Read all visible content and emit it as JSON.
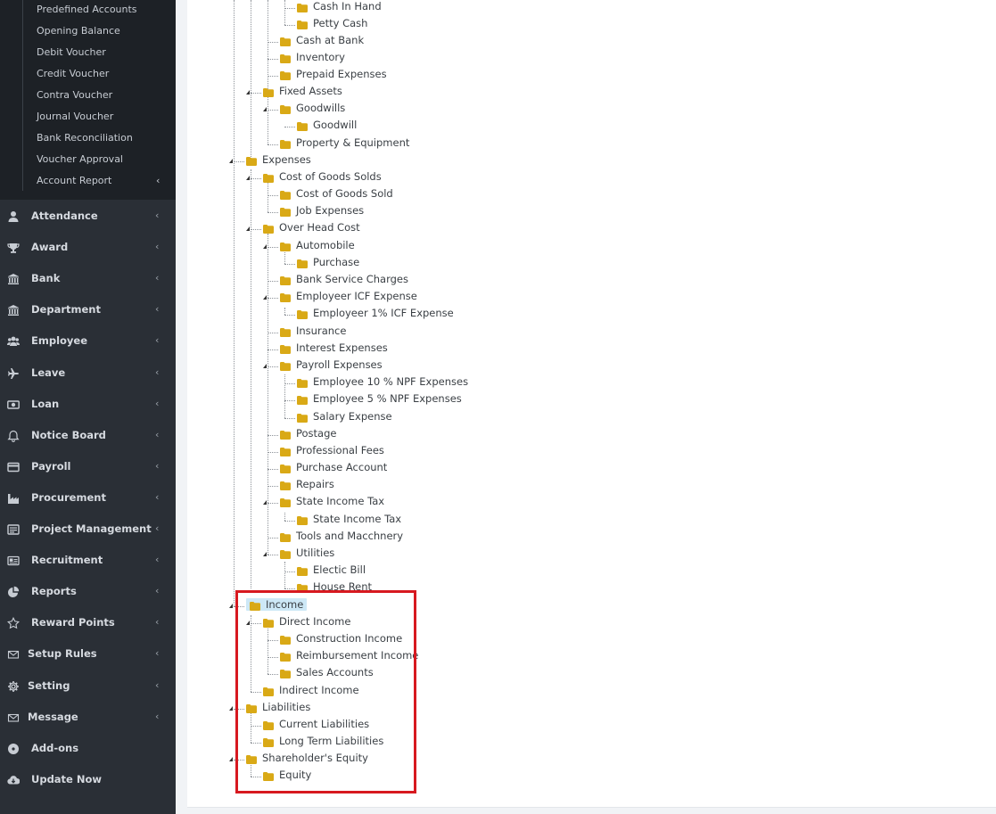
{
  "sidebar": {
    "submenu": [
      {
        "label": "Predefined Accounts"
      },
      {
        "label": "Opening Balance"
      },
      {
        "label": "Debit Voucher"
      },
      {
        "label": "Credit Voucher"
      },
      {
        "label": "Contra Voucher"
      },
      {
        "label": "Journal Voucher"
      },
      {
        "label": "Bank Reconciliation"
      },
      {
        "label": "Voucher Approval"
      },
      {
        "label": "Account Report",
        "chevron": "‹"
      }
    ],
    "items": [
      {
        "label": "Attendance",
        "icon": "user-icon",
        "chevron": "‹"
      },
      {
        "label": "Award",
        "icon": "trophy-icon",
        "chevron": "‹"
      },
      {
        "label": "Bank",
        "icon": "bank-icon",
        "chevron": "‹"
      },
      {
        "label": "Department",
        "icon": "bank-icon",
        "chevron": "‹"
      },
      {
        "label": "Employee",
        "icon": "users-icon",
        "chevron": "‹"
      },
      {
        "label": "Leave",
        "icon": "plane-icon",
        "chevron": "‹"
      },
      {
        "label": "Loan",
        "icon": "money-icon",
        "chevron": "‹"
      },
      {
        "label": "Notice Board",
        "icon": "bell-icon",
        "chevron": "‹"
      },
      {
        "label": "Payroll",
        "icon": "credit-card-icon",
        "chevron": "‹"
      },
      {
        "label": "Procurement",
        "icon": "industry-icon",
        "chevron": "‹"
      },
      {
        "label": "Project Management",
        "icon": "list-icon",
        "chevron": "‹"
      },
      {
        "label": "Recruitment",
        "icon": "id-card-icon",
        "chevron": "‹"
      },
      {
        "label": "Reports",
        "icon": "pie-chart-icon",
        "chevron": "‹"
      },
      {
        "label": "Reward Points",
        "icon": "star-icon",
        "chevron": "‹"
      },
      {
        "label": "Setup Rules",
        "icon": "envelope-icon",
        "chevron": "‹"
      },
      {
        "label": "Setting",
        "icon": "gear-icon",
        "chevron": "‹"
      },
      {
        "label": "Message",
        "icon": "envelope-icon",
        "chevron": "‹"
      },
      {
        "label": "Add-ons",
        "icon": "disc-icon",
        "chevron": ""
      },
      {
        "label": "Update Now",
        "icon": "cloud-download-icon",
        "chevron": ""
      }
    ]
  },
  "tree": [
    {
      "label": "Cash In Hand"
    },
    {
      "label": "Petty Cash"
    },
    {
      "label": "Cash at Bank"
    },
    {
      "label": "Inventory"
    },
    {
      "label": "Prepaid Expenses"
    },
    {
      "label": "Fixed Assets"
    },
    {
      "label": "Goodwills"
    },
    {
      "label": "Goodwill"
    },
    {
      "label": "Property & Equipment"
    },
    {
      "label": "Expenses"
    },
    {
      "label": "Cost of Goods Solds"
    },
    {
      "label": "Cost of Goods Sold"
    },
    {
      "label": "Job Expenses"
    },
    {
      "label": "Over Head Cost"
    },
    {
      "label": "Automobile"
    },
    {
      "label": "Purchase"
    },
    {
      "label": "Bank Service Charges"
    },
    {
      "label": "Employeer ICF Expense"
    },
    {
      "label": "Employeer 1% ICF Expense"
    },
    {
      "label": "Insurance"
    },
    {
      "label": "Interest Expenses"
    },
    {
      "label": "Payroll Expenses"
    },
    {
      "label": "Employee 10 % NPF Expenses"
    },
    {
      "label": "Employee 5 % NPF Expenses"
    },
    {
      "label": "Salary Expense"
    },
    {
      "label": "Postage"
    },
    {
      "label": "Professional Fees"
    },
    {
      "label": "Purchase Account"
    },
    {
      "label": "Repairs"
    },
    {
      "label": "State Income Tax"
    },
    {
      "label": "State Income Tax"
    },
    {
      "label": "Tools and Macchnery"
    },
    {
      "label": "Utilities"
    },
    {
      "label": "Electic Bill"
    },
    {
      "label": "House Rent"
    },
    {
      "label": "Income"
    },
    {
      "label": "Direct Income"
    },
    {
      "label": "Construction Income"
    },
    {
      "label": "Reimbursement Income"
    },
    {
      "label": "Sales Accounts"
    },
    {
      "label": "Indirect Income"
    },
    {
      "label": "Liabilities"
    },
    {
      "label": "Current Liabilities"
    },
    {
      "label": "Long Term Liabilities"
    },
    {
      "label": "Shareholder's Equity"
    },
    {
      "label": "Equity"
    }
  ],
  "colors": {
    "sidebar_bg": "#2a2f36",
    "submenu_bg": "#1d2126",
    "folder": "#d9a916",
    "selected_bg": "#cde8f6",
    "highlight_border": "#d71920"
  }
}
